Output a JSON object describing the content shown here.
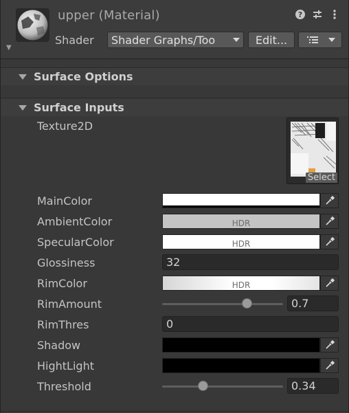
{
  "header": {
    "title": "upper (Material)",
    "shader_label": "Shader",
    "shader_value": "Shader Graphs/Too",
    "edit_label": "Edit...",
    "icons": [
      "help-icon",
      "preset-sliders-icon",
      "kebab-menu-icon"
    ]
  },
  "sections": {
    "surface_options": "Surface Options",
    "surface_inputs": "Surface Inputs"
  },
  "properties": {
    "texture": {
      "label": "Texture2D",
      "select_label": "Select"
    },
    "main_color": {
      "label": "MainColor",
      "color": "#ffffff"
    },
    "ambient_color": {
      "label": "AmbientColor",
      "color": "#c4c4c4",
      "hdr": "HDR"
    },
    "specular_color": {
      "label": "SpecularColor",
      "color": "#ffffff",
      "hdr": "HDR"
    },
    "glossiness": {
      "label": "Glossiness",
      "value": "32"
    },
    "rim_color": {
      "label": "RimColor",
      "hdr": "HDR"
    },
    "rim_amount": {
      "label": "RimAmount",
      "value": "0.7",
      "fraction": 0.7
    },
    "rim_thres": {
      "label": "RimThres",
      "value": "0"
    },
    "shadow": {
      "label": "Shadow",
      "color": "#000000"
    },
    "highlight": {
      "label": "HightLight",
      "color": "#000000"
    },
    "threshold": {
      "label": "Threshold",
      "value": "0.34",
      "fraction": 0.34
    }
  },
  "colors": {
    "panel_bg": "#383838",
    "field_bg": "#2a2a2a",
    "button_bg": "#585858"
  }
}
